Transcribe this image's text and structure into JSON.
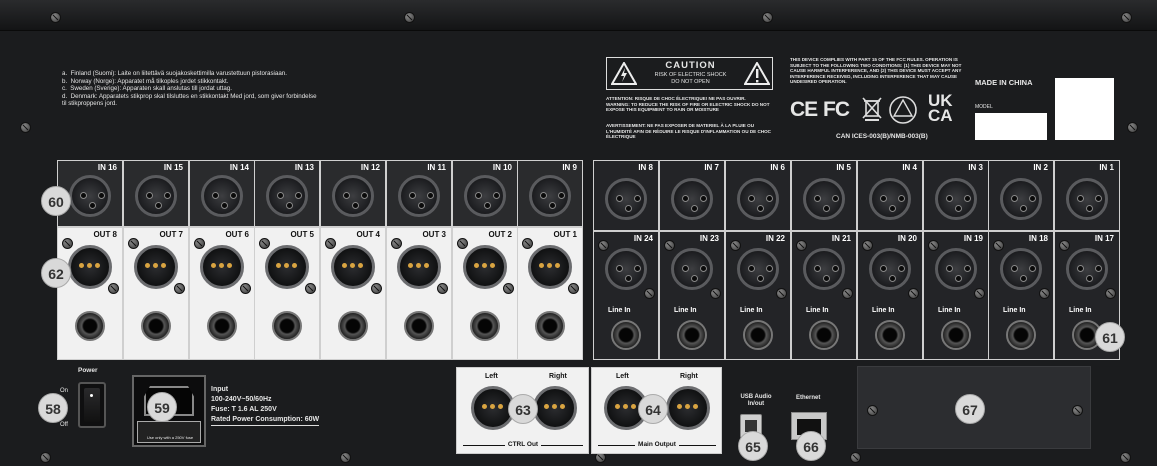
{
  "warnings": {
    "a": "a.",
    "a_text": "Finland (Suomi): Laite on liitettävä suojakoskettimilla varustettuun pistorasiaan.",
    "b": "b.",
    "b_text": "Norway (Norge): Apparatet må tilkoples jordet stikkontakt.",
    "c": "c.",
    "c_text": "Sweden (Sverige): Apparaten skall anslutas till jordat uttag.",
    "d": "d.",
    "d_text": "Denmark: Apparatets stikprop skal tilsluttes en stikkontakt Med jord, som giver forbindelse til stikproppens jord."
  },
  "caution": {
    "title": "CAUTION",
    "line1": "RISK OF ELECTRIC SHOCK",
    "line2": "DO NOT OPEN",
    "fr1": "ATTENTION: RISQUE DE CHOC ÉLECTRIQUE! NE PAS OUVRIR.",
    "en1": "WARNING: TO REDUCE THE RISK OF FIRE OR ELECTRIC SHOCK DO NOT EXPOSE THIS EQUIPMENT TO RAIN OR MOISTURE",
    "fr2": "AVERTISSEMENT: NE PAS EXPOSER DE MATERIEL À LA PLUIE OU L'HUMIDITÉ AFIN DE RÉDUIRE LE RISQUE D'INFLAMMATION OU DE CHOC ÉLECTRIQUE"
  },
  "fcc": {
    "text": "THIS DEVICE COMPLIES WITH PART 15 OF THE FCC RULES. OPERATION IS SUBJECT TO THE FOLLOWING TWO CONDITIONS: (1) THIS DEVICE MAY NOT CAUSE HARMFUL INTERFERENCE, AND (2) THIS DEVICE MUST ACCEPT ANY INTERFERENCE RECEIVED, INCLUDING INTERFERENCE THAT MAY CAUSE UNDESIRED OPERATION.",
    "ce": "CE",
    "fc": "FC",
    "ukca_1": "UK",
    "ukca_2": "CA",
    "ices": "CAN ICES-003(B)/NMB-003(B)"
  },
  "made_in": "MADE IN CHINA",
  "model_label": "MODEL",
  "inputs_top_left": [
    "IN 16",
    "IN 15",
    "IN 14",
    "IN 13",
    "IN 12",
    "IN 11",
    "IN 10",
    "IN 9"
  ],
  "outputs": [
    "OUT 8",
    "OUT 7",
    "OUT 6",
    "OUT 5",
    "OUT 4",
    "OUT 3",
    "OUT 2",
    "OUT 1"
  ],
  "inputs_top_right": [
    "IN 8",
    "IN 7",
    "IN 6",
    "IN 5",
    "IN 4",
    "IN 3",
    "IN 2",
    "IN 1"
  ],
  "inputs_bottom_right": [
    "IN 24",
    "IN 23",
    "IN 22",
    "IN 21",
    "IN 20",
    "IN 19",
    "IN 18",
    "IN 17"
  ],
  "line_in_label": "Line In",
  "power": {
    "label": "Power",
    "on": "On",
    "off": "Off"
  },
  "input_spec": {
    "title": "Input",
    "voltage": "100-240V~50/60Hz",
    "fuse": "Fuse: T 1.6 AL 250V",
    "rated": "Rated Power Consumption: 60W",
    "fuse_note": "Use only with a 250V fuse"
  },
  "ctrl_out": {
    "left": "Left",
    "right": "Right",
    "title": "CTRL Out"
  },
  "main_output": {
    "left": "Left",
    "right": "Right",
    "title": "Main Output"
  },
  "usb": {
    "line1": "USB Audio",
    "line2": "In/out"
  },
  "ethernet": "Ethernet",
  "callouts": {
    "c58": "58",
    "c59": "59",
    "c60": "60",
    "c61": "61",
    "c62": "62",
    "c63": "63",
    "c64": "64",
    "c65": "65",
    "c66": "66",
    "c67": "67"
  }
}
